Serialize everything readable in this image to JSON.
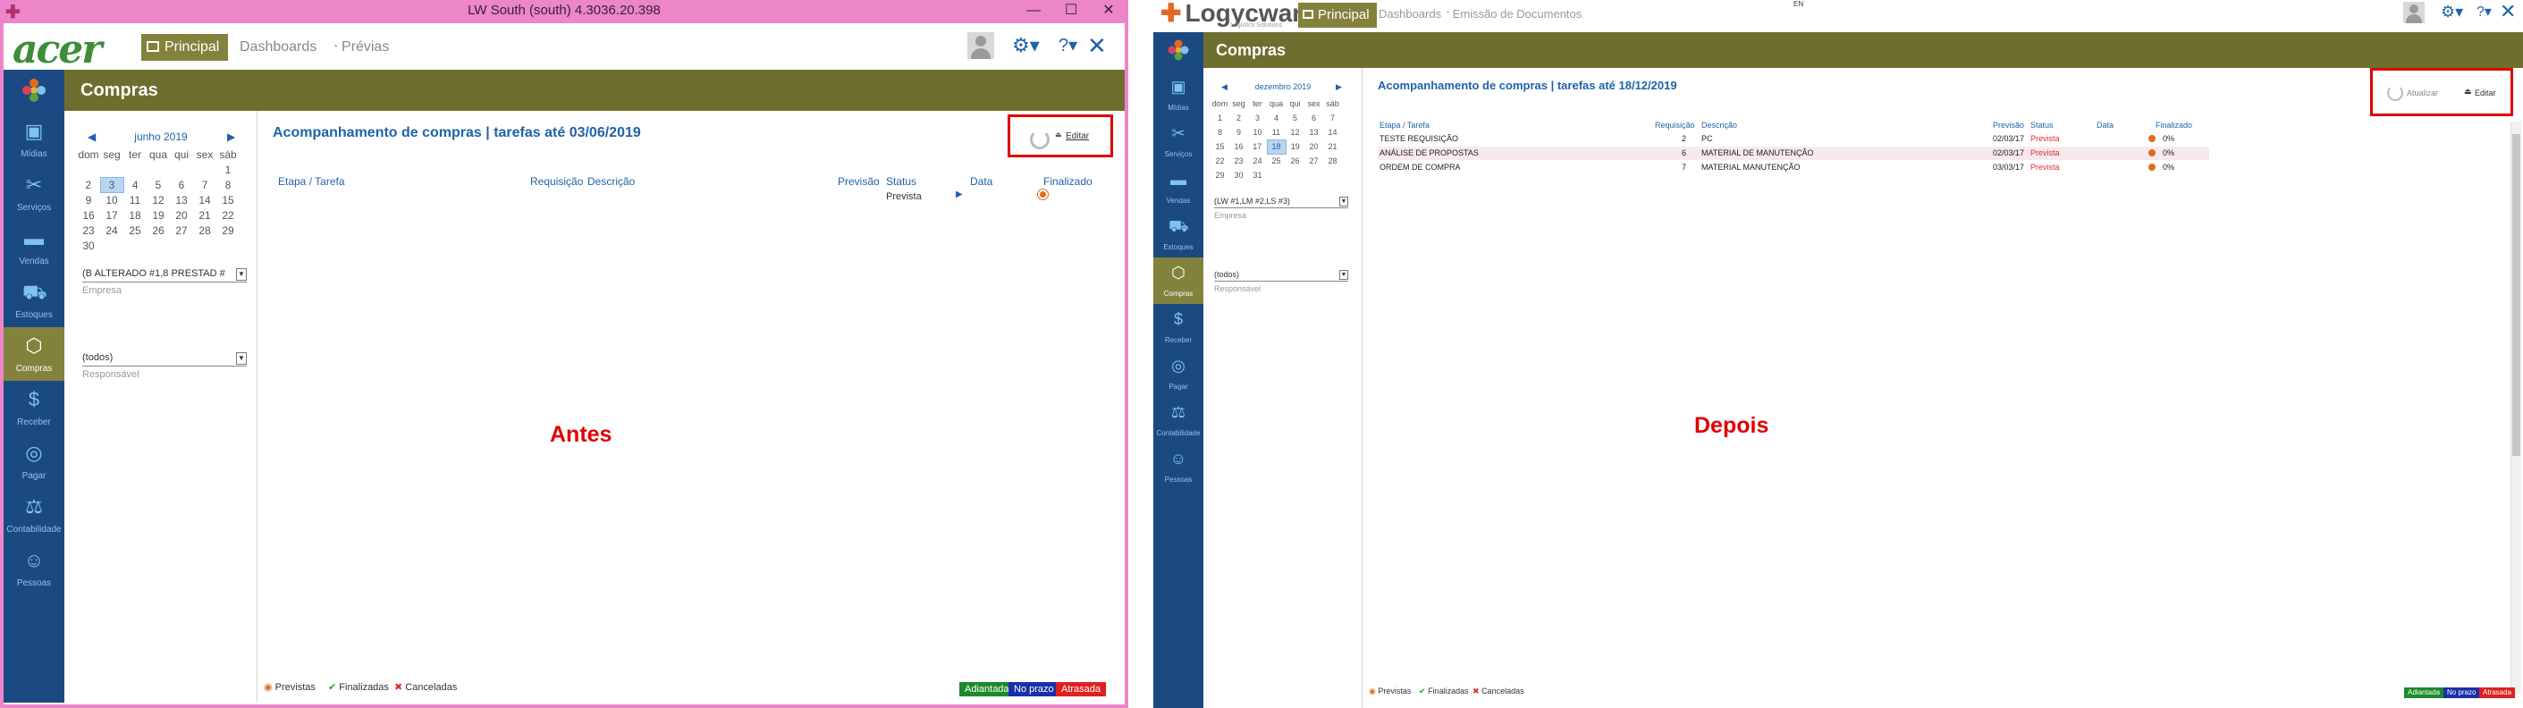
{
  "before": {
    "window_title": "LW South (south) 4.3036.20.398",
    "logo": "acer",
    "tabs": {
      "principal": "Principal",
      "dashboards": "Dashboards",
      "previas": "Prévias"
    },
    "module_title": "Compras",
    "sidebar": [
      "Mídias",
      "Serviços",
      "Vendas",
      "Estoques",
      "Compras",
      "Receber",
      "Pagar",
      "Contabilidade",
      "Pessoas"
    ],
    "calendar": {
      "month": "junho 2019",
      "weekdays": [
        "dom",
        "seg",
        "ter",
        "qua",
        "qui",
        "sex",
        "sáb"
      ],
      "rows": [
        [
          "",
          "",
          "",
          "",
          "",
          "",
          "1"
        ],
        [
          "2",
          "3",
          "4",
          "5",
          "6",
          "7",
          "8"
        ],
        [
          "9",
          "10",
          "11",
          "12",
          "13",
          "14",
          "15"
        ],
        [
          "16",
          "17",
          "18",
          "19",
          "20",
          "21",
          "22"
        ],
        [
          "23",
          "24",
          "25",
          "26",
          "27",
          "28",
          "29"
        ],
        [
          "30",
          "",
          "",
          "",
          "",
          "",
          ""
        ]
      ],
      "selected": "3"
    },
    "empresa_value": "(B ALTERADO #1,8 PRESTAD #",
    "empresa_label": "Empresa",
    "responsavel_value": "(todos)",
    "responsavel_label": "Responsável",
    "main_title": "Acompanhamento de compras | tarefas até 03/06/2019",
    "columns": {
      "etapa": "Etapa / Tarefa",
      "requisicao": "Requisição",
      "descricao": "Descrição",
      "previsao": "Previsão",
      "status": "Status",
      "data": "Data",
      "finalizado": "Finalizado"
    },
    "status_value": "Prevista",
    "edit_label": "Editar",
    "annotation": "Antes",
    "legend": {
      "previstas": "Previstas",
      "finalizadas": "Finalizadas",
      "canceladas": "Canceladas"
    },
    "badges": {
      "adiantada": "Adiantada",
      "no_prazo": "No prazo",
      "atrasada": "Atrasada"
    }
  },
  "after": {
    "logo": "Logycware",
    "logo_sub": "Logistics Solutions",
    "tabs": {
      "principal": "Principal",
      "dashboards": "Dashboards",
      "emissao": "Emissão de Documentos"
    },
    "top_text": "EN",
    "module_title": "Compras",
    "sidebar": [
      "Mídias",
      "Serviços",
      "Vendas",
      "Estoques",
      "Compras",
      "Receber",
      "Pagar",
      "Contabilidade",
      "Pessoas"
    ],
    "calendar": {
      "month": "dezembro 2019",
      "weekdays": [
        "dom",
        "seg",
        "ter",
        "qua",
        "qui",
        "sex",
        "sáb"
      ],
      "rows": [
        [
          "1",
          "2",
          "3",
          "4",
          "5",
          "6",
          "7"
        ],
        [
          "8",
          "9",
          "10",
          "11",
          "12",
          "13",
          "14"
        ],
        [
          "15",
          "16",
          "17",
          "18",
          "19",
          "20",
          "21"
        ],
        [
          "22",
          "23",
          "24",
          "25",
          "26",
          "27",
          "28"
        ],
        [
          "29",
          "30",
          "31",
          "",
          "",
          "",
          ""
        ]
      ],
      "selected": "18"
    },
    "empresa_value": "(LW #1,LM #2,LS #3)",
    "empresa_label": "Empresa",
    "responsavel_value": "(todos)",
    "responsavel_label": "Responsável",
    "main_title": "Acompanhamento de compras | tarefas até 18/12/2019",
    "columns": {
      "etapa": "Etapa / Tarefa",
      "requisicao": "Requisição",
      "descricao": "Descrição",
      "previsao": "Previsão",
      "status": "Status",
      "data": "Data",
      "finalizado": "Finalizado"
    },
    "rows": [
      {
        "etapa": "TESTE REQUISIÇÃO",
        "requisicao": "2",
        "descricao": "PC",
        "previsao": "02/03/17",
        "status": "Prevista",
        "pct": "0%"
      },
      {
        "etapa": "ANÁLISE DE PROPOSTAS",
        "requisicao": "6",
        "descricao": "MATERIAL DE MANUTENÇÃO",
        "previsao": "02/03/17",
        "status": "Prevista",
        "pct": "0%"
      },
      {
        "etapa": "ORDEM DE COMPRA",
        "requisicao": "7",
        "descricao": "MATERIAL MANUTENÇÃO",
        "previsao": "03/03/17",
        "status": "Prevista",
        "pct": "0%"
      }
    ],
    "refresh_label": "Atualizar",
    "edit_label": "Editar",
    "annotation": "Depois",
    "legend": {
      "previstas": "Previstas",
      "finalizadas": "Finalizadas",
      "canceladas": "Canceladas"
    },
    "badges": {
      "adiantada": "Adiantada",
      "no_prazo": "No prazo",
      "atrasada": "Atrasada"
    }
  },
  "colors": {
    "olive": "#6e6e2e",
    "olive_tab": "#83823d",
    "sidebar": "#1b4a82",
    "title_blue": "#1f63a8",
    "pink_frame": "#ec86c8",
    "red": "#e00000",
    "green_badge": "#1d8a2a",
    "blue_badge": "#1a2fa8",
    "red_badge": "#e02020"
  }
}
